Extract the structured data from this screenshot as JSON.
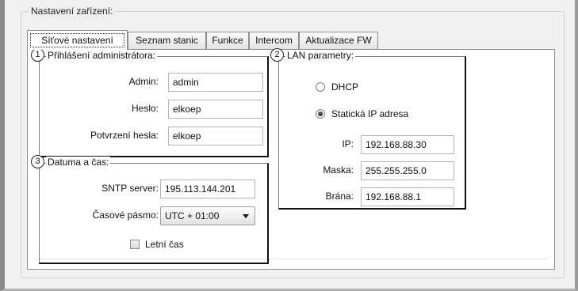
{
  "device_settings": {
    "title": "Nastavení zařízení:",
    "tabs": [
      {
        "label": "Síťové nastavení",
        "active": true
      },
      {
        "label": "Seznam stanic",
        "active": false
      },
      {
        "label": "Funkce",
        "active": false
      },
      {
        "label": "Intercom",
        "active": false
      },
      {
        "label": "Aktualizace FW",
        "active": false
      }
    ]
  },
  "admin_login": {
    "number": "1",
    "title": "Přihlášení administrátora:",
    "admin_label": "Admin:",
    "admin_value": "admin",
    "password_label": "Heslo:",
    "password_value": "elkoep",
    "confirm_label": "Potvrzení hesla:",
    "confirm_value": "elkoep"
  },
  "lan": {
    "number": "2",
    "title": "LAN parametry:",
    "dhcp_label": "DHCP",
    "dhcp_selected": false,
    "static_label": "Statická IP adresa",
    "static_selected": true,
    "ip_label": "IP:",
    "ip_value": "192.168.88.30",
    "mask_label": "Maska:",
    "mask_value": "255.255.255.0",
    "gateway_label": "Brána:",
    "gateway_value": "192.168.88.1"
  },
  "datetime": {
    "number": "3",
    "title": "Datuma a čas:",
    "sntp_label": "SNTP server:",
    "sntp_value": "195.113.144.201",
    "timezone_label": "Časové pásmo:",
    "timezone_value": "UTC + 01:00",
    "dst_label": "Letní čas",
    "dst_checked": false
  },
  "colors": {
    "window_bg": "#f0f0f0",
    "panel_bg": "#ffffff",
    "group_border": "#111111"
  }
}
